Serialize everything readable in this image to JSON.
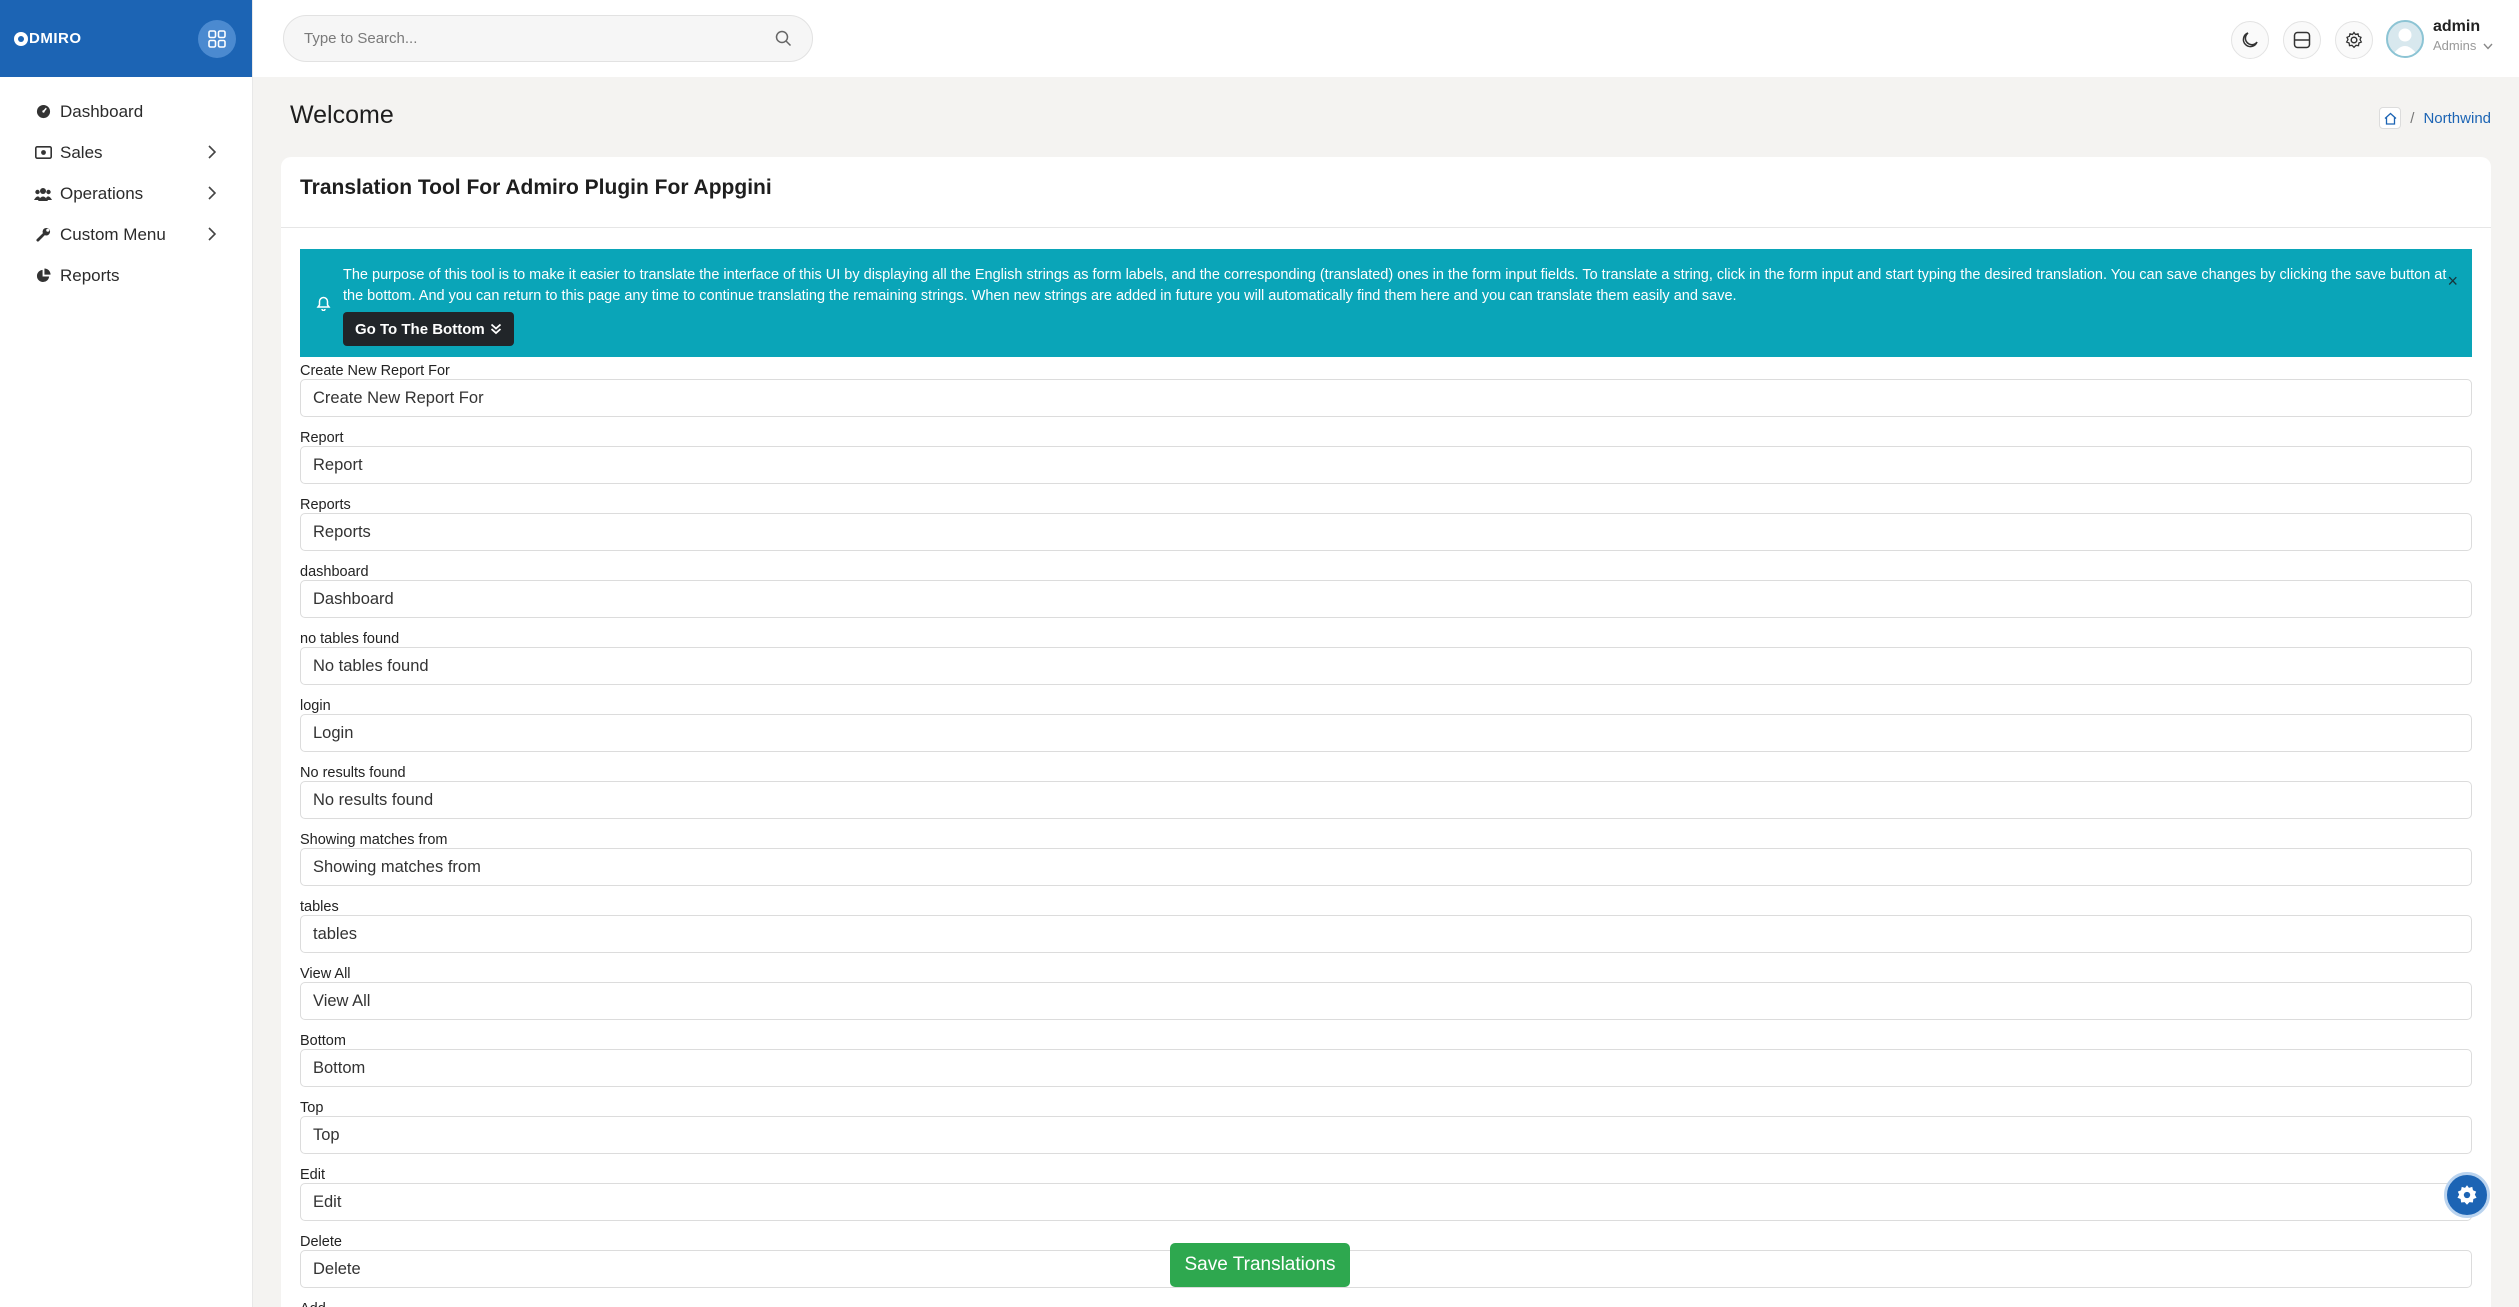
{
  "brand": {
    "name": "DMIRO"
  },
  "search": {
    "placeholder": "Type to Search..."
  },
  "sidebar": {
    "items": [
      {
        "label": "Dashboard",
        "has_children": false
      },
      {
        "label": "Sales",
        "has_children": true
      },
      {
        "label": "Operations",
        "has_children": true
      },
      {
        "label": "Custom Menu",
        "has_children": true
      },
      {
        "label": "Reports",
        "has_children": false
      }
    ]
  },
  "user": {
    "name": "admin",
    "role": "Admins"
  },
  "page": {
    "title": "Welcome"
  },
  "breadcrumb": {
    "current": "Northwind",
    "separator": "/"
  },
  "card": {
    "title": "Translation Tool For Admiro Plugin For Appgini"
  },
  "alert": {
    "text": "The purpose of this tool is to make it easier to translate the interface of this UI by displaying all the English strings as form labels, and the corresponding (translated) ones in the form input fields. To translate a string, click in the form input and start typing the desired translation. You can save changes by clicking the save button at the bottom. And you can return to this page any time to continue translating the remaining strings. When new strings are added in future you will automatically find them here and you can translate them easily and save.",
    "button_label": "Go To The Bottom",
    "close": "×"
  },
  "fields": [
    {
      "label": "Create New Report For",
      "value": "Create New Report For"
    },
    {
      "label": "Report",
      "value": "Report"
    },
    {
      "label": "Reports",
      "value": "Reports"
    },
    {
      "label": "dashboard",
      "value": "Dashboard"
    },
    {
      "label": "no tables found",
      "value": "No tables found"
    },
    {
      "label": "login",
      "value": "Login"
    },
    {
      "label": "No results found",
      "value": "No results found"
    },
    {
      "label": "Showing matches from",
      "value": "Showing matches from"
    },
    {
      "label": "tables",
      "value": "tables"
    },
    {
      "label": "View All",
      "value": "View All"
    },
    {
      "label": "Bottom",
      "value": "Bottom"
    },
    {
      "label": "Top",
      "value": "Top"
    },
    {
      "label": "Edit",
      "value": "Edit"
    },
    {
      "label": "Delete",
      "value": "Delete"
    },
    {
      "label": "Add",
      "value": ""
    }
  ],
  "save_button": {
    "label": "Save Translations"
  },
  "colors": {
    "brand": "#1c64b4",
    "alert": "#0aa5b8",
    "save": "#2ea84f"
  }
}
